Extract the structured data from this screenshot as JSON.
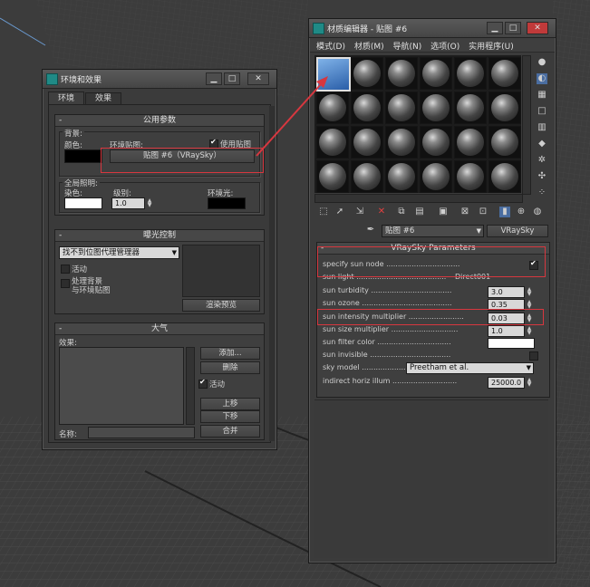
{
  "env_window": {
    "title": "环境和效果",
    "tabs": [
      "环境",
      "效果"
    ],
    "common_params": {
      "header": "公用参数",
      "background_label": "背景:",
      "color_label": "颜色:",
      "env_map_label": "环境贴图:",
      "use_map_label": "使用贴图",
      "map_button": "贴图 #6（VRaySky）",
      "global_lighting_label": "全局照明:",
      "tint_label": "染色:",
      "level_label": "级别:",
      "level_value": "1.0",
      "ambient_label": "环境光:"
    },
    "exposure": {
      "header": "曝光控制",
      "dropdown": "找不到位图代理管理器",
      "active_label": "活动",
      "process_bg_label": "处理背景\n与环境贴图",
      "render_preview": "渲染预览"
    },
    "atmosphere": {
      "header": "大气",
      "effects_label": "效果:",
      "add": "添加...",
      "delete": "删除",
      "active": "活动",
      "move_up": "上移",
      "move_down": "下移",
      "name_label": "名称:",
      "merge": "合并"
    }
  },
  "mat_window": {
    "title": "材质编辑器 - 贴图 #6",
    "menu": [
      "模式(D)",
      "材质(M)",
      "导航(N)",
      "选项(O)",
      "实用程序(U)"
    ],
    "map_name": "贴图 #6",
    "map_type": "VRaySky",
    "rollout_header": "VRaySky Parameters",
    "params": [
      {
        "label": "specify sun node",
        "kind": "check",
        "value": "on"
      },
      {
        "label": "sun light",
        "kind": "text",
        "value": "Direct001"
      },
      {
        "label": "sun turbidity",
        "kind": "spin",
        "value": "3.0"
      },
      {
        "label": "sun ozone",
        "kind": "spin",
        "value": "0.35"
      },
      {
        "label": "sun intensity multiplier",
        "kind": "spin",
        "value": "0.03"
      },
      {
        "label": "sun size multiplier",
        "kind": "spin",
        "value": "1.0"
      },
      {
        "label": "sun filter color",
        "kind": "color",
        "value": "#ffffff"
      },
      {
        "label": "sun invisible",
        "kind": "check",
        "value": "off"
      },
      {
        "label": "sky model",
        "kind": "dropdown",
        "value": "Preetham et al."
      },
      {
        "label": "indirect horiz illum",
        "kind": "spin",
        "value": "25000.0"
      }
    ]
  },
  "colors": {
    "highlight": "#d7373f",
    "accent": "#1f8a86"
  }
}
